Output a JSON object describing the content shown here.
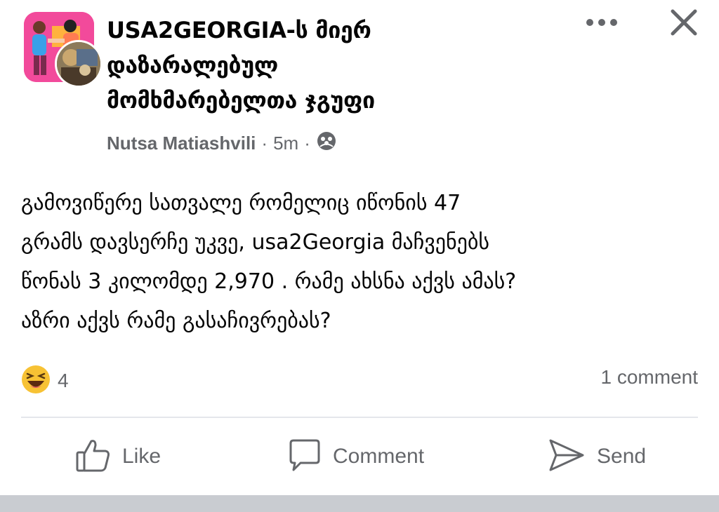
{
  "group": {
    "name": "USA2GEORGIA-ს მიერ\nდაზარალებულ\nმომხმარებელთა ჯგუფი"
  },
  "post": {
    "author": "Nutsa Matiashvili",
    "time": "5m",
    "privacy_icon": "members-icon",
    "text": "გამოვიწერე სათვალე რომელიც იწონის 47\nგრამს დავსერჩე უკვე, usa2Georgia მაჩვენებს\nწონას 3 კილომდე 2,970 . რამე ახსნა აქვს ამას?\nაზრი აქვს რამე გასაჩივრებას?"
  },
  "stats": {
    "reaction_icon": "haha-emoji-icon",
    "reaction_count": "4",
    "comments": "1 comment"
  },
  "actions": {
    "like": "Like",
    "comment": "Comment",
    "send": "Send"
  },
  "colors": {
    "text": "#050505",
    "secondary": "#65676b",
    "divider": "#e4e6eb"
  }
}
